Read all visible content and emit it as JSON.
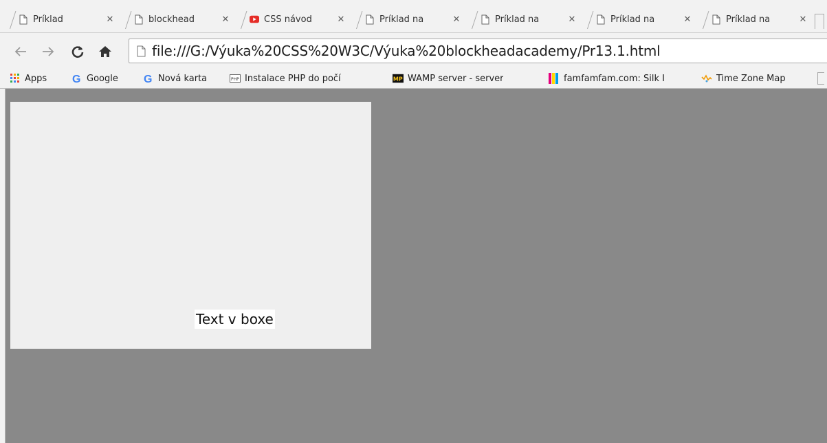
{
  "tabs": [
    {
      "title": "Príklad",
      "icon": "page-icon",
      "close": "✕"
    },
    {
      "title": "blockhead",
      "icon": "page-icon",
      "close": "✕"
    },
    {
      "title": "CSS návod",
      "icon": "youtube-icon",
      "close": "✕"
    },
    {
      "title": "Príklad na",
      "icon": "page-icon",
      "close": "✕"
    },
    {
      "title": "Príklad na",
      "icon": "page-icon",
      "close": "✕"
    },
    {
      "title": "Príklad na",
      "icon": "page-icon",
      "close": "✕"
    },
    {
      "title": "Príklad na",
      "icon": "page-icon",
      "close": "✕"
    }
  ],
  "address_bar": {
    "url": "file:///G:/Výuka%20CSS%20W3C/Výuka%20blockheadacademy/Pr13.1.html"
  },
  "bookmarks": [
    {
      "label": "Apps",
      "icon": "apps-grid-icon"
    },
    {
      "label": "Google",
      "icon": "google-icon"
    },
    {
      "label": "Nová karta",
      "icon": "google-icon"
    },
    {
      "label": "Instalace PHP do počí",
      "icon": "php-icon"
    },
    {
      "label": "WAMP server - server",
      "icon": "mp-icon"
    },
    {
      "label": "famfamfam.com: Silk I",
      "icon": "famfamfam-icon"
    },
    {
      "label": "Time Zone Map",
      "icon": "timezone-icon"
    }
  ],
  "page": {
    "box_text": "Text v boxe"
  },
  "colors": {
    "page_background": "#898989",
    "box_background": "#efefef",
    "text_background": "#ffffff",
    "chrome": "#f2f2f2"
  }
}
